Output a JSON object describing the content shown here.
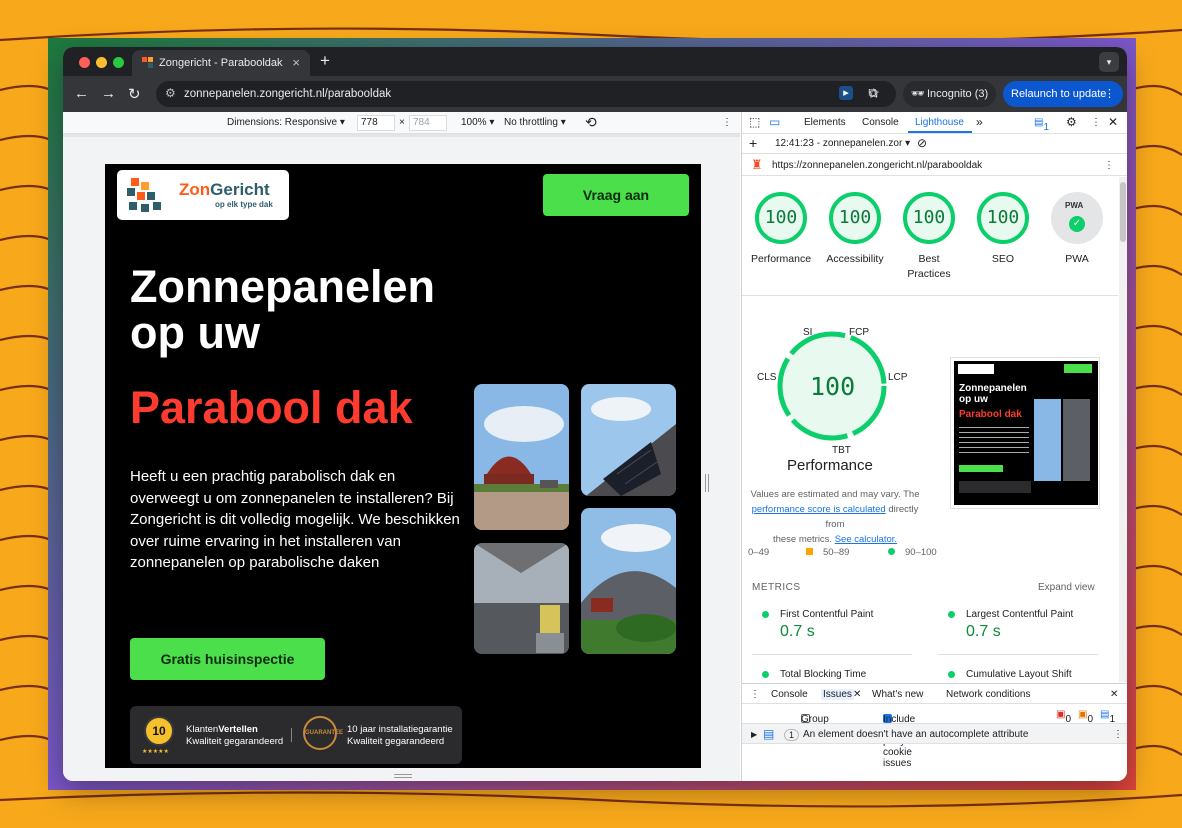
{
  "colors": {
    "accent_green": "#4be04b",
    "brand_red": "#ff3b2f",
    "score_green": "#0cce6b",
    "chrome_dark": "#35363a",
    "devtools_blue": "#1a73e8"
  },
  "browser": {
    "tab_title": "Zongericht - Parabooldak",
    "tab_close": "×",
    "new_tab": "+",
    "url": "zonnepanelen.zongericht.nl/parabooldak",
    "incognito": "Incognito (3)",
    "relaunch": "Relaunch to update",
    "icons": [
      "back-icon",
      "forward-icon",
      "reload-icon",
      "site-info-icon",
      "bookmark-star-icon",
      "extension-icon",
      "puzzle-icon",
      "incognito-icon",
      "kebab-icon"
    ]
  },
  "device_toolbar": {
    "dimensions": "Dimensions: Responsive ▾",
    "width": "778",
    "times": "×",
    "height": "784",
    "zoom": "100% ▾",
    "throttling": "No throttling ▾"
  },
  "site": {
    "logo_name_1": "Zon",
    "logo_name_2": "Gericht",
    "logo_tagline": "op elk type dak",
    "cta": "Vraag aan",
    "headline_1": "Zonnepanelen",
    "headline_2": "op uw",
    "headline_red": "Parabool dak",
    "intro": "Heeft u een prachtig parabolisch dak en overweegt u om zonnepanelen te installeren? Bij Zongericht is dit volledig mogelijk. We beschikken over ruime ervaring in het installeren van zonnepanelen op parabolische daken",
    "button_inspection": "Gratis huisinspectie",
    "trust_badge_score": "10",
    "trust_stars": "★★★★★",
    "trust_1_a": "Klanten",
    "trust_1_b": "Vertellen",
    "trust_1_c": "Kwaliteit gegarandeerd",
    "trust_2_badge": "GUARANTEE",
    "trust_2_a": "10 jaar installatiegarantie",
    "trust_2_b": "Kwaliteit gegarandeerd"
  },
  "devtools": {
    "tabs": [
      "Elements",
      "Console",
      "Lighthouse"
    ],
    "more_tabs": "»",
    "issues_count": "1",
    "report_time": "12:41:23 - zonnepanelen.zor ▾",
    "report_url": "https://zonnepanelen.zongericht.nl/parabooldak",
    "scores": [
      {
        "label": "Performance",
        "value": "100"
      },
      {
        "label": "Accessibility",
        "value": "100"
      },
      {
        "label": "Best Practices",
        "value": "100"
      },
      {
        "label": "SEO",
        "value": "100"
      }
    ],
    "pwa_label": "PWA",
    "pwa_badge": "PWA",
    "gauge_labels": {
      "si": "SI",
      "fcp": "FCP",
      "cls": "CLS",
      "lcp": "LCP",
      "tbt": "TBT"
    },
    "performance_score": "100",
    "performance_title": "Performance",
    "note_1": "Values are estimated and may vary. The",
    "note_link": "performance score is calculated",
    "note_2": "directly from",
    "note_3": "these metrics.",
    "note_link_2": "See calculator.",
    "legend": [
      "0–49",
      "50–89",
      "90–100"
    ],
    "thumb_headline_1": "Zonnepanelen",
    "thumb_headline_2": "op uw",
    "thumb_headline_red": "Parabool dak",
    "metrics_header": "METRICS",
    "expand_view": "Expand view",
    "metrics": [
      {
        "name": "First Contentful Paint",
        "value": "0.7 s"
      },
      {
        "name": "Largest Contentful Paint",
        "value": "0.7 s"
      },
      {
        "name": "Total Blocking Time",
        "value": ""
      },
      {
        "name": "Cumulative Layout Shift",
        "value": ""
      }
    ],
    "drawer_tabs": [
      "Console",
      "Issues",
      "What's new",
      "Network conditions"
    ],
    "group_by_kind": "Group by kind",
    "include_third_party": "Include third-party cookie issues",
    "counts": [
      "0",
      "0",
      "1"
    ],
    "issue_count": "1",
    "issue_text": "An element doesn't have an autocomplete attribute"
  }
}
